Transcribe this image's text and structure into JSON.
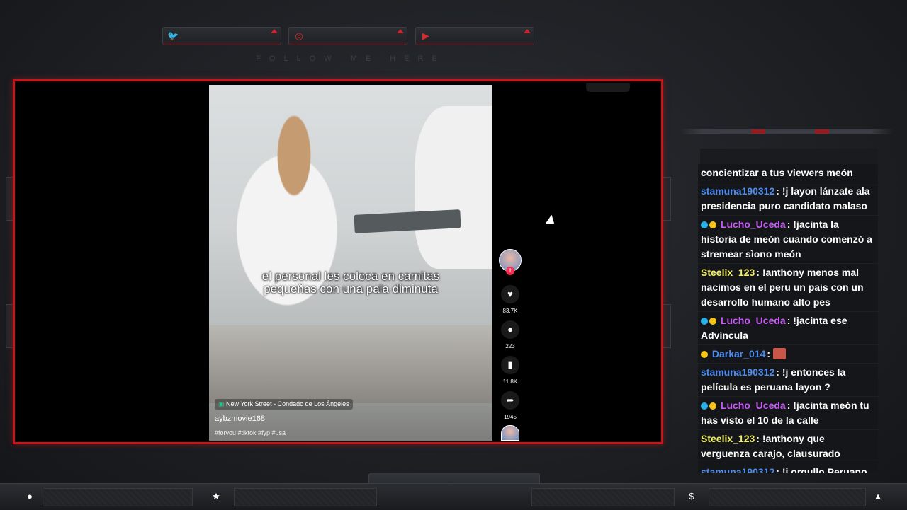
{
  "social": {
    "twitter_icon": "twitter-icon",
    "instagram_icon": "instagram-icon",
    "youtube_icon": "youtube-icon",
    "follow_text": "FOLLOW ME HERE"
  },
  "video": {
    "caption_line1": "el personal les coloca en camitas",
    "caption_line2": "pequeñas con una pala diminuta",
    "location": "New York Street - Condado de Los Ángeles",
    "username": "aybzmovie168",
    "hashtags": "#foryou #tiktok #fyp #usa",
    "likes": "83.7K",
    "comments": "223",
    "saves": "11.8K",
    "shares": "1945"
  },
  "chat": {
    "messages": [
      {
        "user": "",
        "text": "concientizar a tus viewers meón",
        "color": "#ffffff"
      },
      {
        "user": "stamuna190312",
        "text": "!j layon lánzate ala presidencia puro candidato malaso",
        "color": "#4a8cf0"
      },
      {
        "user": "Lucho_Uceda",
        "text": "!jacinta la historia de meón cuando comenzó a stremear sìono meón",
        "color": "#c65cf4"
      },
      {
        "user": "Steelix_123",
        "text": "!anthony menos mal nacimos en el peru un pais con un desarrollo humano alto pes",
        "color": "#f3f06a"
      },
      {
        "user": "Lucho_Uceda",
        "text": "!jacinta ese Advíncula",
        "color": "#c65cf4"
      },
      {
        "user": "Darkar_014",
        "text": "",
        "color": "#4a8cf0"
      },
      {
        "user": "stamuna190312",
        "text": "!j entonces la película es peruana layon ?",
        "color": "#4a8cf0"
      },
      {
        "user": "Lucho_Uceda",
        "text": "!jacinta meón tu has visto el 10 de la calle",
        "color": "#c65cf4"
      },
      {
        "user": "Steelix_123",
        "text": "!anthony que verguenza carajo, clausurado",
        "color": "#f3f06a"
      },
      {
        "user": "stamuna190312",
        "text": "!j orgullo Peruano pe",
        "color": "#4a8cf0"
      }
    ]
  },
  "colors": {
    "accent": "#c8151b",
    "tiktok_red": "#fe2c55"
  }
}
